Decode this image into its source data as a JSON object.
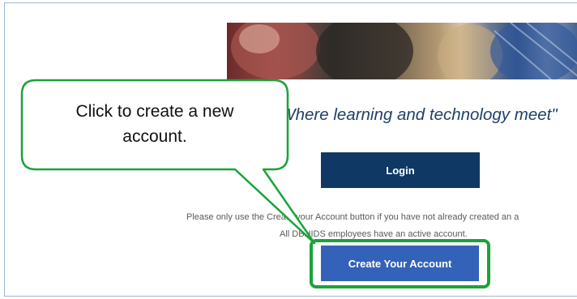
{
  "tagline": "\"Where learning and technology meet\"",
  "login_label": "Login",
  "notice": {
    "line1": "Please only use the Create your Account button if you have not already created an a",
    "line2": "All DBHIDS employees have an active account."
  },
  "create_account_label": "Create Your Account",
  "callout": {
    "text": "Click to create a new\naccount.",
    "border_color": "#1aa33a"
  },
  "colors": {
    "login_button": "#0f3864",
    "create_button": "#3462b8",
    "tagline": "#1f3f68",
    "highlight": "#1aa33a"
  },
  "hero_image": "photo-strip"
}
